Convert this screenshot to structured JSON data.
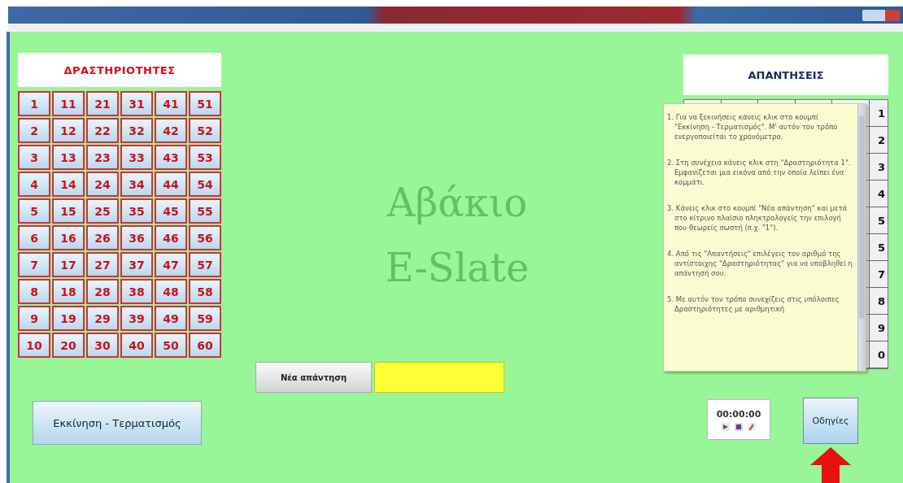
{
  "activities": {
    "title": "ΔΡΑΣΤΗΡΙΟΤΗΤΕΣ",
    "buttons": [
      "1",
      "11",
      "21",
      "31",
      "41",
      "51",
      "2",
      "12",
      "22",
      "32",
      "42",
      "52",
      "3",
      "13",
      "23",
      "33",
      "43",
      "53",
      "4",
      "14",
      "24",
      "34",
      "44",
      "54",
      "5",
      "15",
      "25",
      "35",
      "45",
      "55",
      "6",
      "16",
      "26",
      "36",
      "46",
      "56",
      "7",
      "17",
      "27",
      "37",
      "47",
      "57",
      "8",
      "18",
      "28",
      "38",
      "48",
      "58",
      "9",
      "19",
      "29",
      "39",
      "49",
      "59",
      "10",
      "20",
      "30",
      "40",
      "50",
      "60"
    ]
  },
  "logo": {
    "lines": [
      "Αβάκιο",
      "E-Slate"
    ]
  },
  "new_answer_button": "Νέα απάντηση",
  "start_button": "Εκκίνηση - Τερματισμός",
  "answers": {
    "title": "ΑΠΑΝΤΗΣΕΙΣ",
    "numbers": [
      "1",
      "2",
      "3",
      "4",
      "5",
      "5",
      "7",
      "8",
      "9",
      "0"
    ]
  },
  "help_popup": {
    "items": [
      "1. Για να ξεκινήσεις κάνεις κλικ στο κουμπί \"Εκκίνηση - Τερματισμός\". Μ' αυτόν τον τρόπο ενεργοποιείται το χρονόμετρο.",
      "2. Στη συνέχεια κάνεις κλικ στη \"Δραστηριότητα 1\". Εμφανίζεται μια εικόνα από την οποία λείπει ένα κομμάτι.",
      "3. Κάνεις κλικ στο κουμπί \"Νέα απάντηση\" και μετά στο κίτρινο πλαίσιο πληκτρολογείς την επιλογή που θεωρείς σωστή (π.χ. \"1\").",
      "4. Από τις \"Απαντήσεις\" επιλέγεις τον αριθμό της αντίστοιχης \"Δραστηριότητας\" για να υποβληθεί η απάντησή σου.",
      "5. Με αυτόν τον τρόπο συνεχίζεις στις υπόλοιπες Δραστηριότητες με αριθμητική"
    ]
  },
  "timer": {
    "time": "00:00:00"
  },
  "help_button": "Οδηγίες"
}
